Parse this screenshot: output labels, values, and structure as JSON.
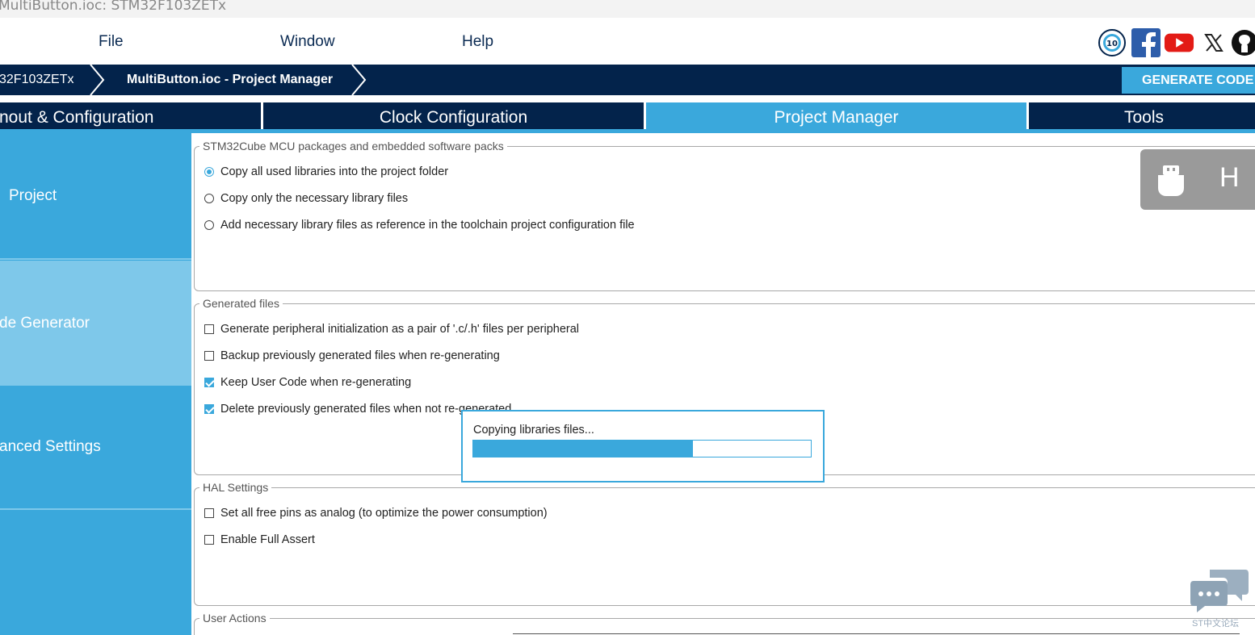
{
  "window": {
    "title": "MultiButton.ioc: STM32F103ZETx"
  },
  "menu": {
    "items": [
      "File",
      "Window",
      "Help"
    ]
  },
  "breadcrumb": {
    "items": [
      "32F103ZETx",
      "MultiButton.ioc - Project Manager"
    ]
  },
  "generate_button": {
    "label": "GENERATE CODE"
  },
  "tabs": [
    {
      "label": "nout & Configuration",
      "active": false
    },
    {
      "label": "Clock Configuration",
      "active": false
    },
    {
      "label": "Project Manager",
      "active": true
    },
    {
      "label": "Tools",
      "active": false
    }
  ],
  "sidebar": {
    "items": [
      {
        "label": "Project",
        "active": false
      },
      {
        "label": "de Generator",
        "active": true
      },
      {
        "label": "anced Settings",
        "active": false
      }
    ]
  },
  "packages": {
    "legend": "STM32Cube MCU packages and embedded software packs",
    "options": [
      {
        "label": "Copy all used libraries into the project folder",
        "selected": true
      },
      {
        "label": "Copy only the necessary library files",
        "selected": false
      },
      {
        "label": "Add necessary library files as reference in the toolchain project configuration file",
        "selected": false
      }
    ]
  },
  "generated_files": {
    "legend": "Generated files",
    "options": [
      {
        "label": "Generate peripheral initialization as a pair of '.c/.h' files per peripheral",
        "checked": false
      },
      {
        "label": "Backup previously generated files when re-generating",
        "checked": false
      },
      {
        "label": "Keep User Code when re-generating",
        "checked": true
      },
      {
        "label": "Delete previously generated files when not re-generated",
        "checked": true
      }
    ]
  },
  "hal_settings": {
    "legend": "HAL Settings",
    "options": [
      {
        "label": "Set all free pins as analog (to optimize the power consumption)",
        "checked": false
      },
      {
        "label": "Enable Full Assert",
        "checked": false
      }
    ]
  },
  "user_actions": {
    "legend": "User Actions"
  },
  "widget": {
    "letter": "H"
  },
  "progress_dialog": {
    "message": "Copying libraries files...",
    "progress": 0.65
  },
  "chat": {
    "label": "ST中文论坛"
  },
  "colors": {
    "navy": "#03234b",
    "accent": "#3aa8dc",
    "sidebar_active": "#7ec8ea"
  },
  "icons": [
    "st-anniversary-icon",
    "facebook-icon",
    "youtube-icon",
    "x-icon",
    "github-icon",
    "usb-icon",
    "chat-icon"
  ]
}
